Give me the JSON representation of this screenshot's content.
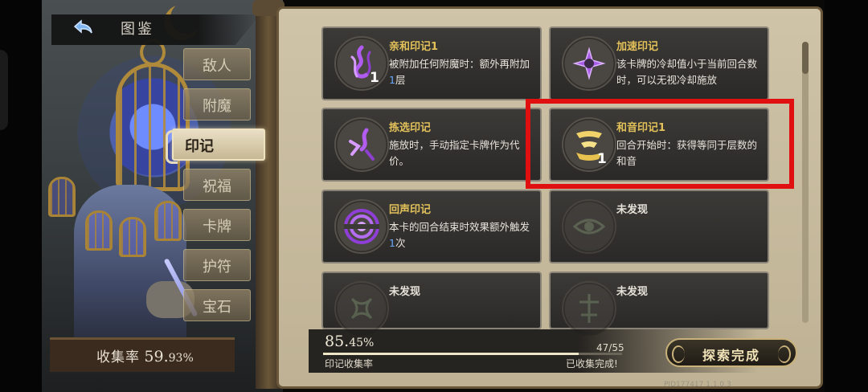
{
  "header": {
    "title": "图鉴"
  },
  "tabs": [
    {
      "label": "敌人",
      "active": false
    },
    {
      "label": "附魔",
      "active": false
    },
    {
      "label": "印记",
      "active": true
    },
    {
      "label": "祝福",
      "active": false
    },
    {
      "label": "卡牌",
      "active": false
    },
    {
      "label": "护符",
      "active": false
    },
    {
      "label": "宝石",
      "active": false
    }
  ],
  "collection": {
    "prefix": "收集率",
    "int": "59.",
    "dec": "93%"
  },
  "cards": [
    {
      "name": "亲和印记1",
      "desc_a": "被附加任何附魔时：额外再附加",
      "num": "1",
      "desc_b": "层",
      "lvl": "1",
      "icon": "affinity-mark-icon",
      "color": "#b05cf0"
    },
    {
      "name": "加速印记",
      "desc_a": "该卡牌的冷却值小于当前回合数时，可以无视冷却施放",
      "num": "",
      "desc_b": "",
      "lvl": "",
      "icon": "haste-mark-icon",
      "color": "#a85ce8"
    },
    {
      "name": "拣选印记",
      "desc_a": "施放时，手动指定卡牌作为代价。",
      "num": "",
      "desc_b": "",
      "lvl": "",
      "icon": "pick-mark-icon",
      "color": "#b25cf0"
    },
    {
      "name": "和音印记1",
      "desc_a": "回合开始时：获得等同于层数的和音",
      "num": "",
      "desc_b": "",
      "lvl": "1",
      "icon": "harmony-mark-icon",
      "color": "#f2d36a"
    },
    {
      "name": "回声印记",
      "desc_a": "本卡的回合结束时效果额外触发",
      "num": "1",
      "desc_b": "次",
      "lvl": "",
      "icon": "echo-mark-icon",
      "color": "#a24fe0"
    },
    {
      "name": "未发现",
      "desc_a": "",
      "num": "",
      "desc_b": "",
      "lvl": "",
      "icon": "undiscovered-eye-icon",
      "color": "#7c8a6e"
    },
    {
      "name": "未发现",
      "desc_a": "",
      "num": "",
      "desc_b": "",
      "lvl": "",
      "icon": "undiscovered-knot-icon",
      "color": "#7c8a6e"
    },
    {
      "name": "未发现",
      "desc_a": "",
      "num": "",
      "desc_b": "",
      "lvl": "",
      "icon": "undiscovered-rune-icon",
      "color": "#7c8a6e"
    }
  ],
  "progress": {
    "int": "85.",
    "dec": "45%",
    "label": "印记收集率",
    "count": "47/55",
    "status": "已收集完成!",
    "fill": 0.8545
  },
  "explore_button": {
    "label": "探索完成"
  },
  "version": "PID177417  1.1.0.3",
  "colors": {
    "highlight": "#e01010",
    "gold": "#e2c15a",
    "number_blue": "#6aa8ff"
  }
}
